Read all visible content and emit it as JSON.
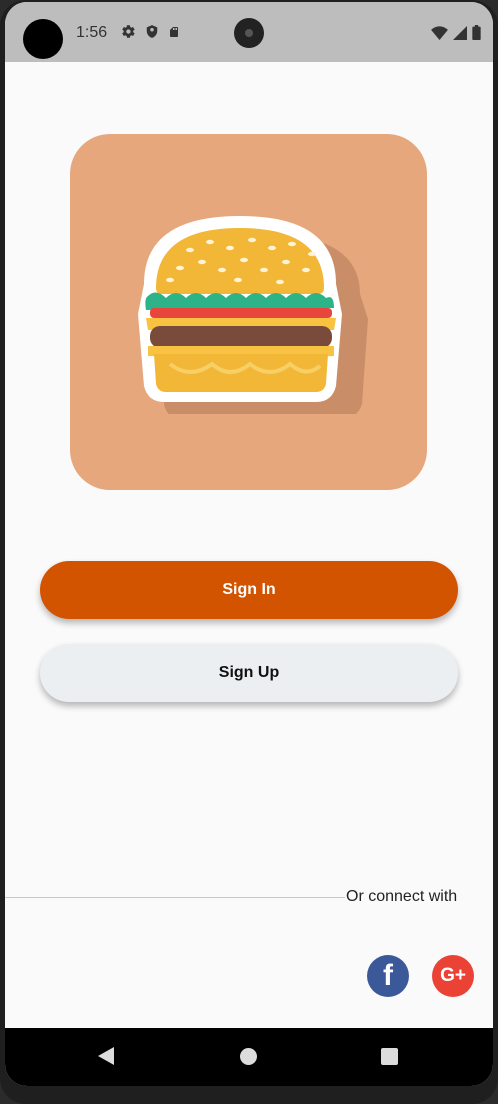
{
  "status_bar": {
    "time": "1:56",
    "icons_left": [
      "gear-icon",
      "shield-icon",
      "sd-card-icon"
    ],
    "icons_right": [
      "wifi-icon",
      "signal-icon",
      "battery-icon"
    ]
  },
  "app": {
    "logo_icon": "burger-icon",
    "logo_background": "#e6a77d"
  },
  "buttons": {
    "sign_in": "Sign In",
    "sign_up": "Sign Up",
    "sign_in_color": "#d35400",
    "sign_up_color": "#eceff1"
  },
  "social": {
    "connect_text": "Or connect with",
    "facebook_glyph": "f",
    "google_glyph": "G+"
  },
  "nav": {
    "items": [
      "back-icon",
      "home-icon",
      "recents-icon"
    ]
  }
}
